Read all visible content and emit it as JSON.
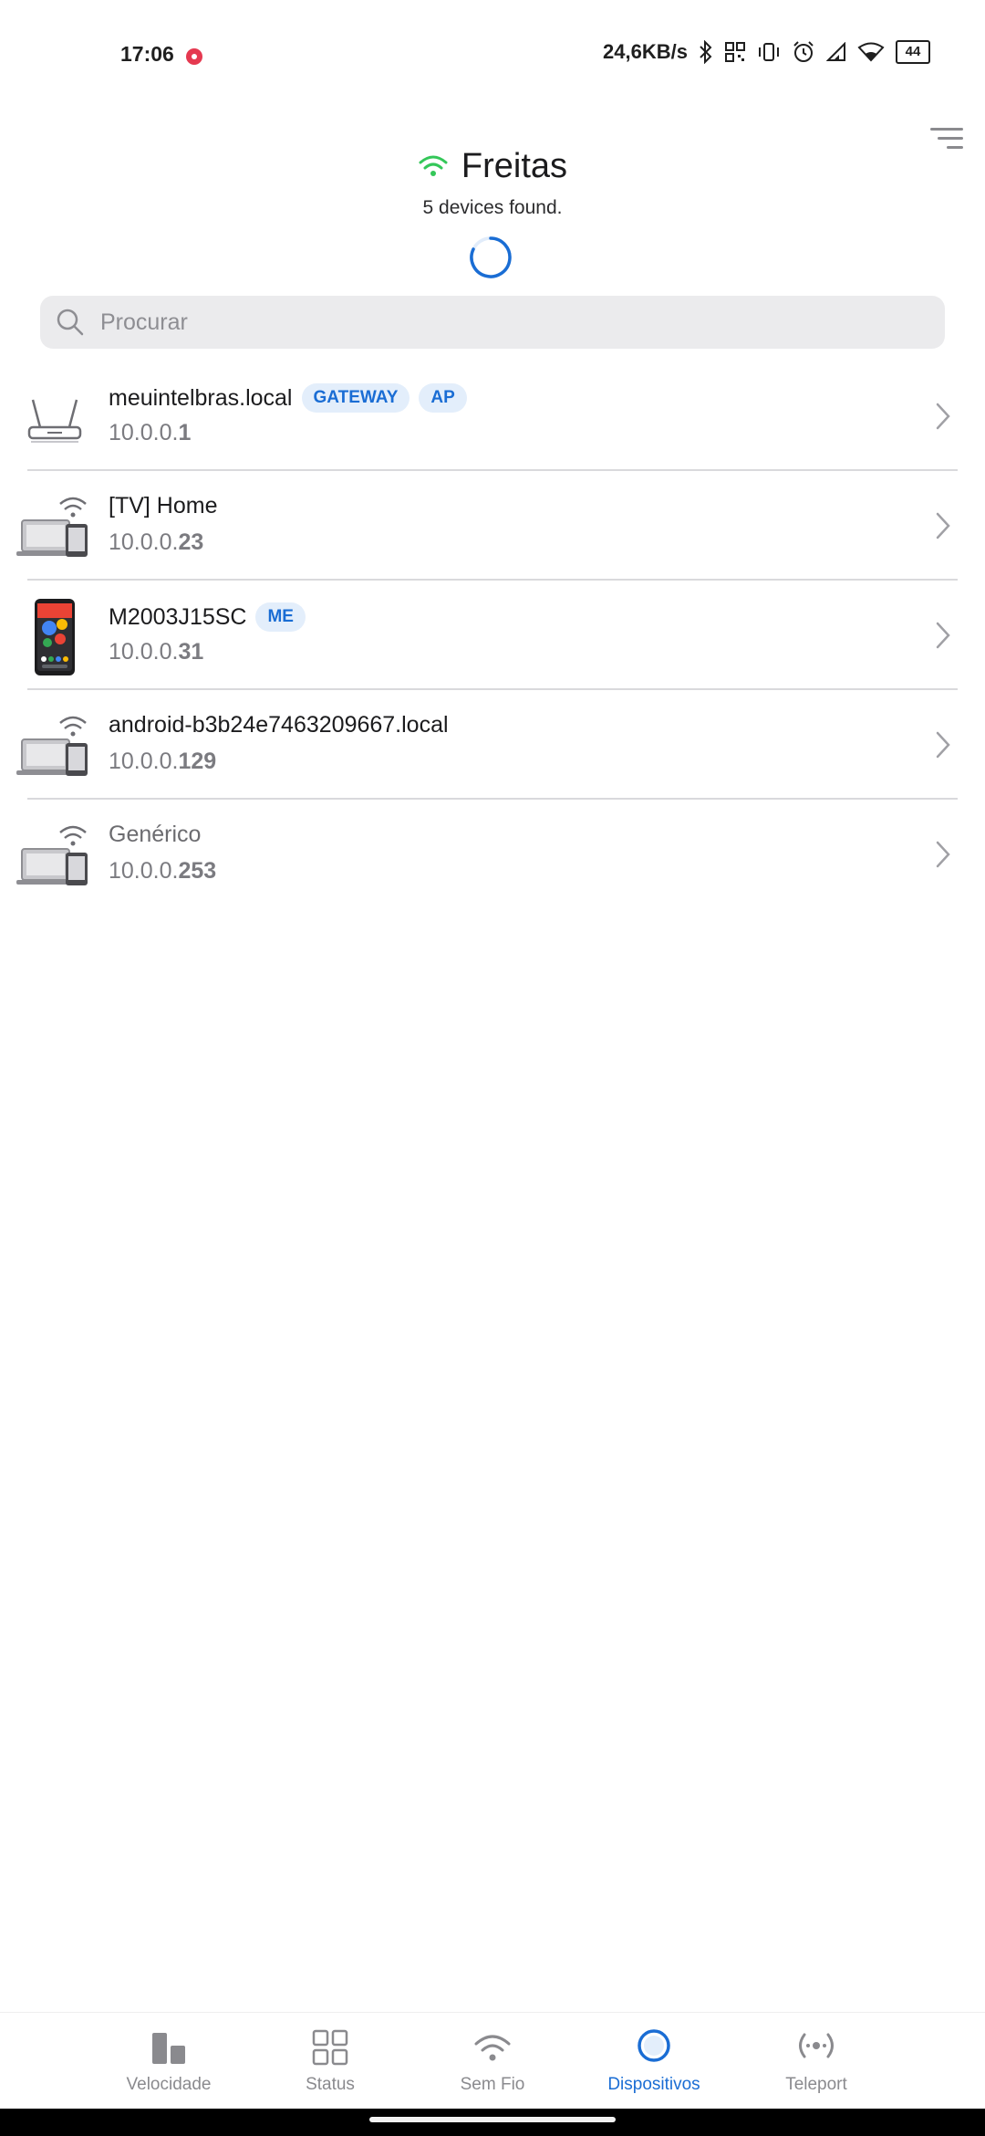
{
  "status_bar": {
    "time": "17:06",
    "speed": "24,6KB/s",
    "battery": "44"
  },
  "header": {
    "network_name": "Freitas",
    "subtitle": "5 devices found."
  },
  "search": {
    "placeholder": "Procurar"
  },
  "devices": [
    {
      "name": "meuintelbras.local",
      "ip_prefix": "10.0.0.",
      "ip_suffix": "1",
      "badges": [
        "GATEWAY",
        "AP"
      ],
      "icon": "router-icon"
    },
    {
      "name": "[TV] Home",
      "ip_prefix": "10.0.0.",
      "ip_suffix": "23",
      "badges": [],
      "icon": "wireless-device-icon"
    },
    {
      "name": "M2003J15SC",
      "ip_prefix": "10.0.0.",
      "ip_suffix": "31",
      "badges": [
        "ME"
      ],
      "icon": "smartphone-icon"
    },
    {
      "name": "android-b3b24e7463209667.local",
      "ip_prefix": "10.0.0.",
      "ip_suffix": "129",
      "badges": [],
      "icon": "wireless-device-icon"
    },
    {
      "name": "Genérico",
      "ip_prefix": "10.0.0.",
      "ip_suffix": "253",
      "badges": [],
      "icon": "wireless-device-icon"
    }
  ],
  "bottom_nav": {
    "items": [
      {
        "label": "Velocidade",
        "icon": "speed-bars-icon"
      },
      {
        "label": "Status",
        "icon": "grid-icon"
      },
      {
        "label": "Sem Fio",
        "icon": "wifi-icon"
      },
      {
        "label": "Dispositivos",
        "icon": "devices-circle-icon",
        "active": true
      },
      {
        "label": "Teleport",
        "icon": "teleport-icon"
      }
    ]
  },
  "colors": {
    "accent": "#1a6dd4",
    "wifi_green": "#34c759",
    "badge_bg": "#e3eefb",
    "muted_text": "#7b7b80"
  }
}
